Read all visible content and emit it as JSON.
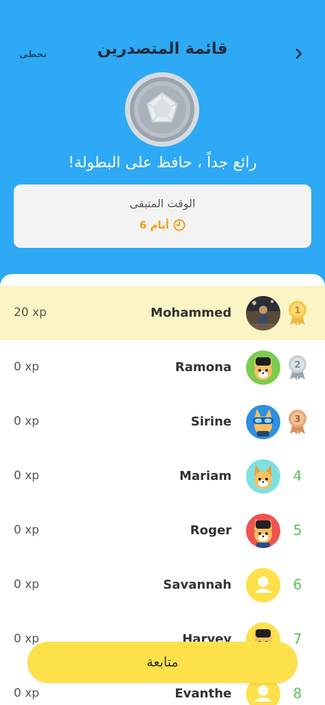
{
  "header": {
    "skip_label": "تخطى",
    "title": "قائمة المتصدرين",
    "praise": "!رائع جداً ، حافظ على البطولة"
  },
  "time_card": {
    "label": "الوقت المتبقى",
    "value": "أيام 6"
  },
  "leaderboard": [
    {
      "rank": "1",
      "name": "Mohammed",
      "xp": "20 xp",
      "medal": "gold",
      "avatar": "photo-avatar"
    },
    {
      "rank": "2",
      "name": "Ramona",
      "xp": "0 xp",
      "medal": "silver",
      "avatar": "fox-green-avatar"
    },
    {
      "rank": "3",
      "name": "Sirine",
      "xp": "0 xp",
      "medal": "bronze",
      "avatar": "fox-goggles-avatar"
    },
    {
      "rank": "4",
      "name": "Mariam",
      "xp": "0 xp",
      "medal": "",
      "avatar": "fox-cyan-avatar"
    },
    {
      "rank": "5",
      "name": "Roger",
      "xp": "0 xp",
      "medal": "",
      "avatar": "fox-red-avatar"
    },
    {
      "rank": "6",
      "name": "Savannah",
      "xp": "0 xp",
      "medal": "",
      "avatar": "default-user-avatar"
    },
    {
      "rank": "7",
      "name": "Harvey",
      "xp": "0 xp",
      "medal": "",
      "avatar": "fox-helmet-avatar"
    },
    {
      "rank": "8",
      "name": "Evanthe",
      "xp": "0 xp",
      "medal": "",
      "avatar": "default-user-avatar"
    }
  ],
  "continue_label": "متابعة",
  "colors": {
    "header_bg": "#2DA9F5",
    "highlight_row": "#FBF4C4",
    "button": "#FCE14A",
    "rank_number": "#59c25a",
    "time_accent": "#f39c12"
  }
}
